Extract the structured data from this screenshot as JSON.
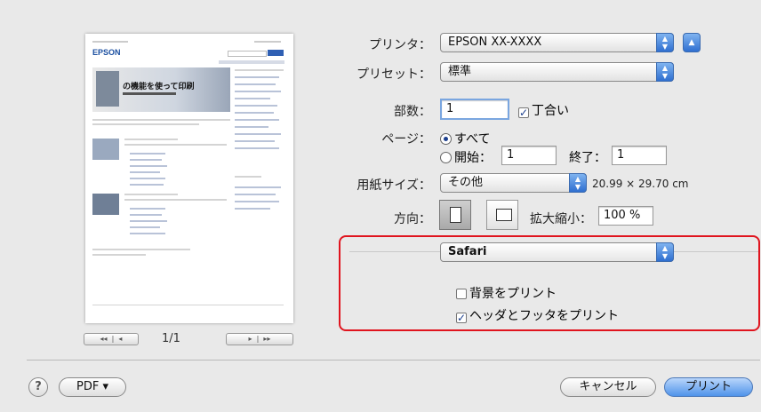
{
  "printer": {
    "label": "プリンタ：",
    "value": "EPSON XX-XXXX"
  },
  "preset": {
    "label": "プリセット：",
    "value": "標準"
  },
  "copies": {
    "label": "部数：",
    "value": "1",
    "collated_label": "丁合い",
    "collated_checked": true
  },
  "pages": {
    "label": "ページ：",
    "all_label": "すべて",
    "from_label": "開始：",
    "from_value": "1",
    "to_label": "終了：",
    "to_value": "1"
  },
  "paper_size": {
    "label": "用紙サイズ：",
    "value": "その他",
    "dimensions": "20.99 × 29.70 cm"
  },
  "orientation": {
    "label": "方向：",
    "scale_label": "拡大縮小：",
    "scale_value": "100 %"
  },
  "safari_section": {
    "popup_value": "Safari",
    "background_label": "背景をプリント",
    "background_checked": false,
    "headers_label": "ヘッダとフッタをプリント",
    "headers_checked": true
  },
  "preview": {
    "page_indicator": "1/1",
    "logo": "EPSON",
    "banner": "の機能を使って印刷"
  },
  "bottom": {
    "help": "?",
    "pdf": "PDF ▾",
    "cancel": "キャンセル",
    "print": "プリント"
  },
  "colors": {
    "highlight": "#e0141e",
    "accent": "#2f6fd0"
  }
}
